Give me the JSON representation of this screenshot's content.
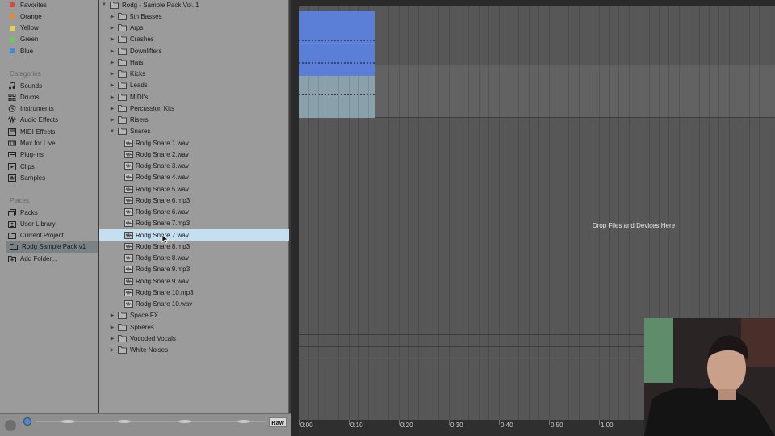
{
  "colors": {
    "favorites_red": "#d84b3a",
    "orange": "#e58a2c",
    "yellow": "#e6d53a",
    "green": "#6bc85a",
    "blue": "#3f8bd6",
    "clip_blue": "#5b7fd6",
    "clip_grey": "#8aa0ab",
    "selection": "#c3dff0"
  },
  "sidebar": {
    "collections": [
      {
        "label": "Favorites",
        "color": "#d84b3a"
      },
      {
        "label": "Orange",
        "color": "#e58a2c"
      },
      {
        "label": "Yellow",
        "color": "#e6d53a"
      },
      {
        "label": "Green",
        "color": "#6bc85a"
      },
      {
        "label": "Blue",
        "color": "#3f8bd6"
      }
    ],
    "categories_header": "Categories",
    "categories": [
      {
        "label": "Sounds",
        "icon": "music-note-icon"
      },
      {
        "label": "Drums",
        "icon": "drum-pads-icon"
      },
      {
        "label": "Instruments",
        "icon": "instrument-clock-icon"
      },
      {
        "label": "Audio Effects",
        "icon": "audio-effects-icon"
      },
      {
        "label": "MIDI Effects",
        "icon": "midi-effects-icon"
      },
      {
        "label": "Max for Live",
        "icon": "max-for-live-icon"
      },
      {
        "label": "Plug-ins",
        "icon": "plugin-icon"
      },
      {
        "label": "Clips",
        "icon": "clip-icon"
      },
      {
        "label": "Samples",
        "icon": "sample-icon"
      }
    ],
    "places_header": "Places",
    "places": [
      {
        "label": "Packs",
        "icon": "packs-icon"
      },
      {
        "label": "User Library",
        "icon": "user-library-icon"
      },
      {
        "label": "Current Project",
        "icon": "folder-icon"
      },
      {
        "label": "Rodg Sample Pack v1",
        "icon": "folder-icon"
      },
      {
        "label": "Add Folder...",
        "icon": "add-folder-icon"
      }
    ]
  },
  "browser": {
    "root": "Rodg - Sample Pack Vol. 1",
    "folders_before": [
      "5th Basses",
      "Arps",
      "Crashes",
      "Downlifters",
      "Hats",
      "Kicks",
      "Leads",
      "MIDI's",
      "Percussion Kits",
      "Risers"
    ],
    "open_folder": "Snares",
    "files": [
      "Rodg Snare 1.wav",
      "Rodg Snare 2.wav",
      "Rodg Snare 3.wav",
      "Rodg Snare 4.wav",
      "Rodg Snare 5.wav",
      "Rodg Snare 6.mp3",
      "Rodg Snare 6.wav",
      "Rodg Snare 7.mp3",
      "Rodg Snare 7.wav",
      "Rodg Snare 8.mp3",
      "Rodg Snare 8.wav",
      "Rodg Snare 9.mp3",
      "Rodg Snare 9.wav",
      "Rodg Snare 10.mp3",
      "Rodg Snare 10.wav"
    ],
    "selected_file": "Rodg Snare 7.wav",
    "folders_after": [
      "Space FX",
      "Spheres",
      "Vocoded Vocals",
      "White Noises"
    ]
  },
  "bottom": {
    "raw_label": "Raw"
  },
  "arrangement": {
    "drop_text": "Drop Files and Devices Here",
    "ruler": [
      "0:00",
      "0:10",
      "0:20",
      "0:30",
      "0:40",
      "0:50",
      "1:00"
    ]
  }
}
